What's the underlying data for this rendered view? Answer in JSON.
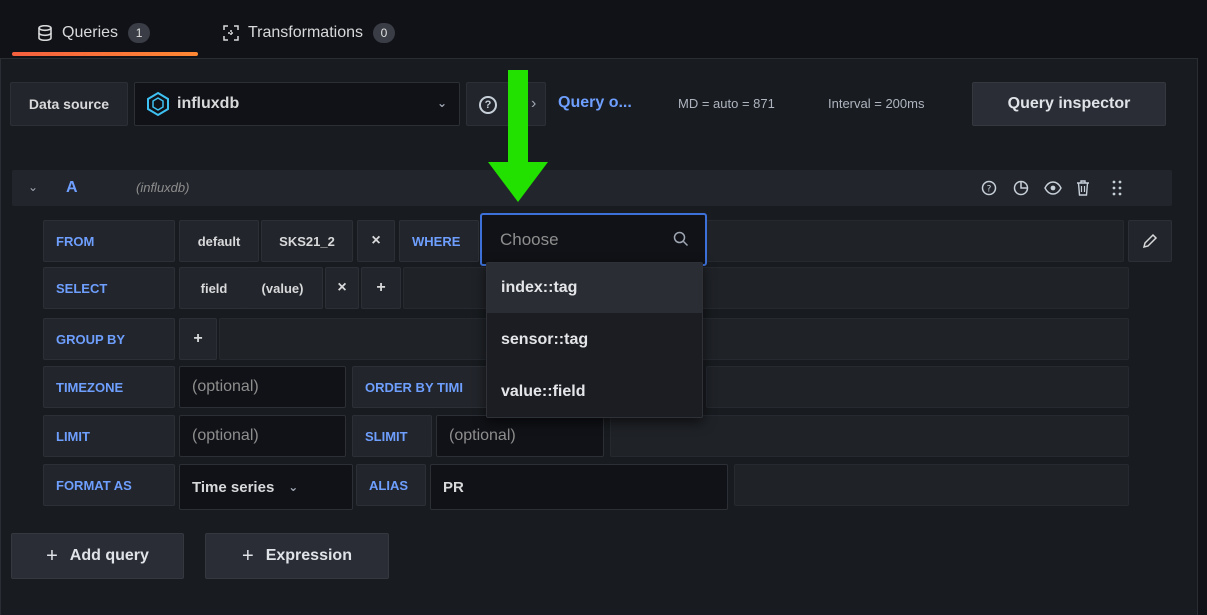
{
  "tabs": [
    {
      "label": "Queries",
      "count": "1",
      "icon": "database-icon"
    },
    {
      "label": "Transformations",
      "count": "0",
      "icon": "transform-icon"
    }
  ],
  "datasource": {
    "label": "Data source",
    "value": "influxdb",
    "query_options": "Query o...",
    "md": "MD = auto = 871",
    "interval": "Interval = 200ms",
    "inspector": "Query inspector"
  },
  "query": {
    "name": "A",
    "datasource": "(influxdb)",
    "from": {
      "keyword": "FROM",
      "policy": "default",
      "measurement": "SKS21_2",
      "remove": "×",
      "where": "WHERE",
      "where_placeholder": "Choose"
    },
    "select": {
      "keyword": "SELECT",
      "field": "field",
      "value": "(value)",
      "remove": "×",
      "add": "+"
    },
    "group_by": {
      "keyword": "GROUP BY",
      "add": "+"
    },
    "timezone": {
      "keyword": "TIMEZONE",
      "placeholder": "(optional)",
      "order_by": "ORDER BY TIMI"
    },
    "limit": {
      "keyword": "LIMIT",
      "placeholder": "(optional)",
      "slimit": "SLIMIT",
      "slimit_placeholder": "(optional)"
    },
    "format": {
      "keyword": "FORMAT AS",
      "value": "Time series",
      "alias_keyword": "ALIAS",
      "alias": "PR"
    }
  },
  "where_options": [
    "index::tag",
    "sensor::tag",
    "value::field"
  ],
  "buttons": {
    "add_query": "Add query",
    "expression": "Expression",
    "plus": "+"
  },
  "colors": {
    "accent": "#6e9fff",
    "arrow": "#22e000",
    "focus": "#3d71d9"
  }
}
